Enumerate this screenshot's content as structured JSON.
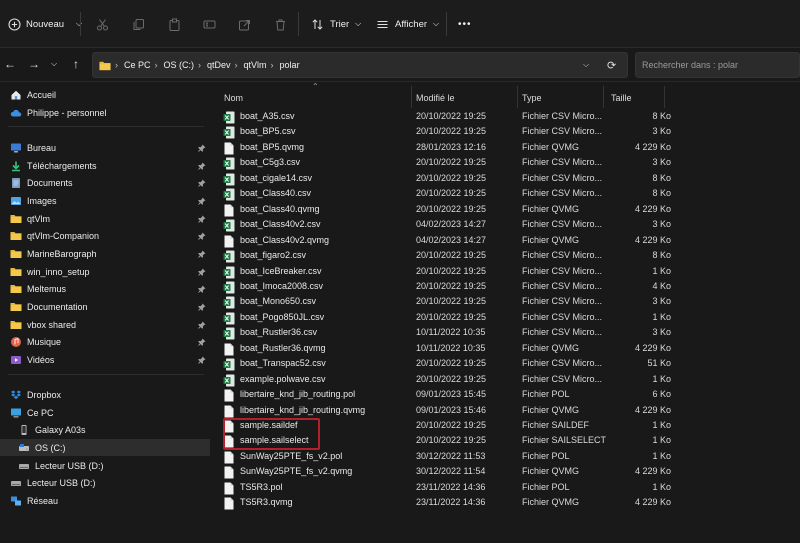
{
  "toolbar": {
    "new_label": "Nouveau",
    "sort_label": "Trier",
    "view_label": "Afficher",
    "more_label": "•••"
  },
  "address": {
    "crumbs": [
      "Ce PC",
      "OS (C:)",
      "qtDev",
      "qtVlm",
      "polar"
    ],
    "search_placeholder": "Rechercher dans : polar"
  },
  "sidebar": {
    "items": [
      {
        "label": "Accueil",
        "icon": "home-icon"
      },
      {
        "label": "Philippe - personnel",
        "icon": "cloud-icon"
      },
      {
        "label": "Bureau",
        "icon": "desktop-icon",
        "pinned": true
      },
      {
        "label": "Téléchargements",
        "icon": "download-icon",
        "pinned": true
      },
      {
        "label": "Documents",
        "icon": "documents-icon",
        "pinned": true
      },
      {
        "label": "Images",
        "icon": "images-icon",
        "pinned": true
      },
      {
        "label": "qtVlm",
        "icon": "folder-icon",
        "pinned": true
      },
      {
        "label": "qtVlm-Companion",
        "icon": "folder-icon",
        "pinned": true
      },
      {
        "label": "MarineBarograph",
        "icon": "folder-icon",
        "pinned": true
      },
      {
        "label": "win_inno_setup",
        "icon": "folder-icon",
        "pinned": true
      },
      {
        "label": "Meltemus",
        "icon": "folder-icon",
        "pinned": true
      },
      {
        "label": "Documentation",
        "icon": "folder-icon",
        "pinned": true
      },
      {
        "label": "vbox shared",
        "icon": "folder-icon",
        "pinned": true
      },
      {
        "label": "Musique",
        "icon": "music-icon",
        "pinned": true
      },
      {
        "label": "Vidéos",
        "icon": "video-icon",
        "pinned": true
      },
      {
        "label": "Dropbox",
        "icon": "dropbox-icon"
      },
      {
        "label": "Ce PC",
        "icon": "computer-icon"
      },
      {
        "label": "Galaxy A03s",
        "icon": "phone-icon"
      },
      {
        "label": "OS (C:)",
        "icon": "drive-icon",
        "selected": true
      },
      {
        "label": "Lecteur USB (D:)",
        "icon": "usb-drive-icon"
      },
      {
        "label": "Lecteur USB (D:)",
        "icon": "usb-drive-icon"
      },
      {
        "label": "Réseau",
        "icon": "network-icon"
      }
    ]
  },
  "columns": {
    "name": "Nom",
    "modified": "Modifié le",
    "type": "Type",
    "size": "Taille"
  },
  "files": [
    {
      "name": "boat_A35.csv",
      "date": "20/10/2022 19:25",
      "type": "Fichier CSV Micro...",
      "size": "8 Ko",
      "kind": "csv"
    },
    {
      "name": "boat_BP5.csv",
      "date": "20/10/2022 19:25",
      "type": "Fichier CSV Micro...",
      "size": "3 Ko",
      "kind": "csv"
    },
    {
      "name": "boat_BP5.qvmg",
      "date": "28/01/2023 12:16",
      "type": "Fichier QVMG",
      "size": "4 229 Ko",
      "kind": "doc"
    },
    {
      "name": "boat_C5g3.csv",
      "date": "20/10/2022 19:25",
      "type": "Fichier CSV Micro...",
      "size": "3 Ko",
      "kind": "csv"
    },
    {
      "name": "boat_cigale14.csv",
      "date": "20/10/2022 19:25",
      "type": "Fichier CSV Micro...",
      "size": "8 Ko",
      "kind": "csv"
    },
    {
      "name": "boat_Class40.csv",
      "date": "20/10/2022 19:25",
      "type": "Fichier CSV Micro...",
      "size": "8 Ko",
      "kind": "csv"
    },
    {
      "name": "boat_Class40.qvmg",
      "date": "20/10/2022 19:25",
      "type": "Fichier QVMG",
      "size": "4 229 Ko",
      "kind": "doc"
    },
    {
      "name": "boat_Class40v2.csv",
      "date": "04/02/2023 14:27",
      "type": "Fichier CSV Micro...",
      "size": "3 Ko",
      "kind": "csv"
    },
    {
      "name": "boat_Class40v2.qvmg",
      "date": "04/02/2023 14:27",
      "type": "Fichier QVMG",
      "size": "4 229 Ko",
      "kind": "doc"
    },
    {
      "name": "boat_figaro2.csv",
      "date": "20/10/2022 19:25",
      "type": "Fichier CSV Micro...",
      "size": "8 Ko",
      "kind": "csv"
    },
    {
      "name": "boat_IceBreaker.csv",
      "date": "20/10/2022 19:25",
      "type": "Fichier CSV Micro...",
      "size": "1 Ko",
      "kind": "csv"
    },
    {
      "name": "boat_Imoca2008.csv",
      "date": "20/10/2022 19:25",
      "type": "Fichier CSV Micro...",
      "size": "4 Ko",
      "kind": "csv"
    },
    {
      "name": "boat_Mono650.csv",
      "date": "20/10/2022 19:25",
      "type": "Fichier CSV Micro...",
      "size": "3 Ko",
      "kind": "csv"
    },
    {
      "name": "boat_Pogo850JL.csv",
      "date": "20/10/2022 19:25",
      "type": "Fichier CSV Micro...",
      "size": "1 Ko",
      "kind": "csv"
    },
    {
      "name": "boat_Rustler36.csv",
      "date": "10/11/2022 10:35",
      "type": "Fichier CSV Micro...",
      "size": "3 Ko",
      "kind": "csv"
    },
    {
      "name": "boat_Rustler36.qvmg",
      "date": "10/11/2022 10:35",
      "type": "Fichier QVMG",
      "size": "4 229 Ko",
      "kind": "doc"
    },
    {
      "name": "boat_Transpac52.csv",
      "date": "20/10/2022 19:25",
      "type": "Fichier CSV Micro...",
      "size": "51 Ko",
      "kind": "csv"
    },
    {
      "name": "example.polwave.csv",
      "date": "20/10/2022 19:25",
      "type": "Fichier CSV Micro...",
      "size": "1 Ko",
      "kind": "csv"
    },
    {
      "name": "libertaire_knd_jib_routing.pol",
      "date": "09/01/2023 15:45",
      "type": "Fichier POL",
      "size": "6 Ko",
      "kind": "doc"
    },
    {
      "name": "libertaire_knd_jib_routing.qvmg",
      "date": "09/01/2023 15:46",
      "type": "Fichier QVMG",
      "size": "4 229 Ko",
      "kind": "doc"
    },
    {
      "name": "sample.saildef",
      "date": "20/10/2022 19:25",
      "type": "Fichier SAILDEF",
      "size": "1 Ko",
      "kind": "doc"
    },
    {
      "name": "sample.sailselect",
      "date": "20/10/2022 19:25",
      "type": "Fichier SAILSELECT",
      "size": "1 Ko",
      "kind": "doc"
    },
    {
      "name": "SunWay25PTE_fs_v2.pol",
      "date": "30/12/2022 11:53",
      "type": "Fichier POL",
      "size": "1 Ko",
      "kind": "doc"
    },
    {
      "name": "SunWay25PTE_fs_v2.qvmg",
      "date": "30/12/2022 11:54",
      "type": "Fichier QVMG",
      "size": "4 229 Ko",
      "kind": "doc"
    },
    {
      "name": "TS5R3.pol",
      "date": "23/11/2022 14:36",
      "type": "Fichier POL",
      "size": "1 Ko",
      "kind": "doc"
    },
    {
      "name": "TS5R3.qvmg",
      "date": "23/11/2022 14:36",
      "type": "Fichier QVMG",
      "size": "4 229 Ko",
      "kind": "doc"
    }
  ],
  "colors": {
    "background": "#191919",
    "csv_icon": "#1f7a46",
    "folder_icon": "#e8b938",
    "highlight": "#b3202c"
  }
}
